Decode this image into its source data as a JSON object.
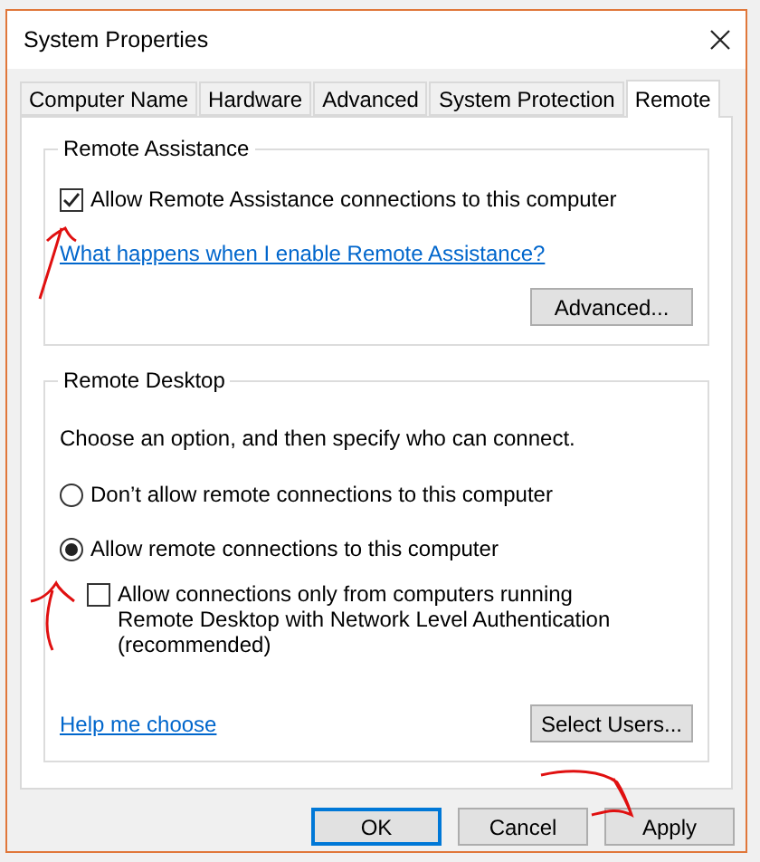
{
  "window": {
    "title": "System Properties"
  },
  "tabs": [
    {
      "label": "Computer Name",
      "selected": false
    },
    {
      "label": "Hardware",
      "selected": false
    },
    {
      "label": "Advanced",
      "selected": false
    },
    {
      "label": "System Protection",
      "selected": false
    },
    {
      "label": "Remote",
      "selected": true
    }
  ],
  "remote_assistance": {
    "title": "Remote Assistance",
    "allow": {
      "label": "Allow Remote Assistance connections to this computer",
      "checked": true
    },
    "help_link": "What happens when I enable Remote Assistance?",
    "advanced_button": "Advanced..."
  },
  "remote_desktop": {
    "title": "Remote Desktop",
    "instruction": "Choose an option, and then specify who can connect.",
    "options": [
      {
        "label": "Don’t allow remote connections to this computer",
        "selected": false
      },
      {
        "label": "Allow remote connections to this computer",
        "selected": true
      }
    ],
    "nla": {
      "label": "Allow connections only from computers running Remote Desktop with Network Level Authentication (recommended)",
      "checked": false
    },
    "help_link": "Help me choose",
    "select_users_button": "Select Users..."
  },
  "buttons": [
    {
      "label": "OK",
      "kind": "default"
    },
    {
      "label": "Cancel",
      "kind": "normal"
    },
    {
      "label": "Apply",
      "kind": "normal"
    }
  ]
}
